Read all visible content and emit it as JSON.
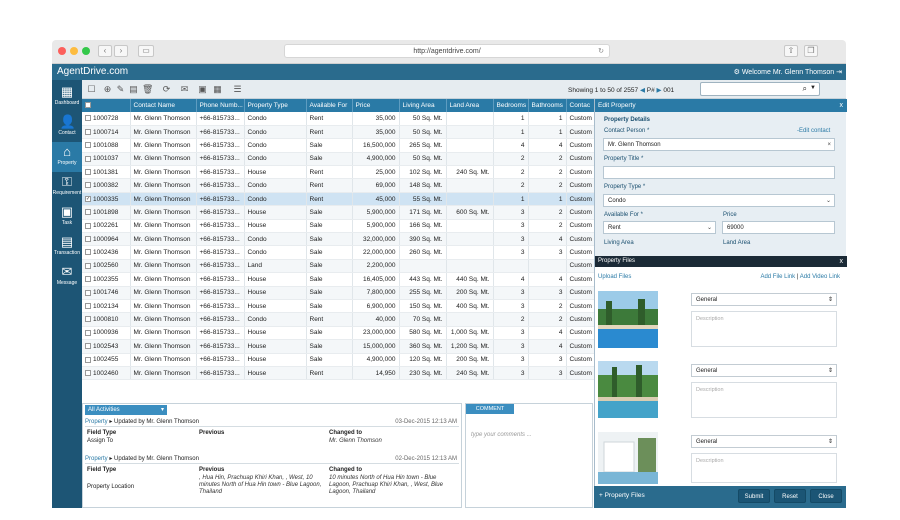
{
  "browser": {
    "url": "http://agentdrive.com/"
  },
  "app": {
    "logo": "AgentDrive.com",
    "welcome": "Welcome Mr. Glenn Thomson"
  },
  "sidebar": {
    "items": [
      {
        "label": "Dashboard",
        "icon": "dashboard-icon",
        "glyph": "▦"
      },
      {
        "label": "Contact",
        "icon": "contact-icon",
        "glyph": "👤"
      },
      {
        "label": "Property",
        "icon": "home-icon",
        "glyph": "⌂"
      },
      {
        "label": "Requirement",
        "icon": "key-icon",
        "glyph": "⚿"
      },
      {
        "label": "Task",
        "icon": "calendar-icon",
        "glyph": "▣"
      },
      {
        "label": "Transaction",
        "icon": "briefcase-icon",
        "glyph": "▤"
      },
      {
        "label": "Message",
        "icon": "mail-icon",
        "glyph": "✉"
      }
    ]
  },
  "toolbar": {
    "showing": "Showing 1 to 50 of 2557",
    "page_label": "P#",
    "page": "001"
  },
  "table": {
    "columns": [
      "",
      "Contact Name",
      "Phone Numb...",
      "Property Type",
      "Available For",
      "Price",
      "Living Area",
      "Land Area",
      "Bedrooms",
      "Bathrooms",
      "Contac"
    ],
    "rows": [
      [
        "1000728",
        "Mr. Glenn Thomson",
        "+66-815733...",
        "Condo",
        "Rent",
        "35,000",
        "50 Sq. Mt.",
        "",
        "1",
        "1",
        "Custom"
      ],
      [
        "1000714",
        "Mr. Glenn Thomson",
        "+66-815733...",
        "Condo",
        "Rent",
        "35,000",
        "50 Sq. Mt.",
        "",
        "1",
        "1",
        "Custom"
      ],
      [
        "1001088",
        "Mr. Glenn Thomson",
        "+66-815733...",
        "Condo",
        "Sale",
        "16,500,000",
        "265 Sq. Mt.",
        "",
        "4",
        "4",
        "Custom"
      ],
      [
        "1001037",
        "Mr. Glenn Thomson",
        "+66-815733...",
        "Condo",
        "Sale",
        "4,900,000",
        "50 Sq. Mt.",
        "",
        "2",
        "2",
        "Custom"
      ],
      [
        "1001381",
        "Mr. Glenn Thomson",
        "+66-815733...",
        "House",
        "Rent",
        "25,000",
        "102 Sq. Mt.",
        "240 Sq. Mt.",
        "2",
        "2",
        "Custom"
      ],
      [
        "1000382",
        "Mr. Glenn Thomson",
        "+66-815733...",
        "Condo",
        "Rent",
        "69,000",
        "148 Sq. Mt.",
        "",
        "2",
        "2",
        "Custom"
      ],
      [
        "1000335",
        "Mr. Glenn Thomson",
        "+66-815733...",
        "Condo",
        "Rent",
        "45,000",
        "55 Sq. Mt.",
        "",
        "1",
        "1",
        "Custom"
      ],
      [
        "1001898",
        "Mr. Glenn Thomson",
        "+66-815733...",
        "House",
        "Sale",
        "5,900,000",
        "171 Sq. Mt.",
        "600 Sq. Mt.",
        "3",
        "2",
        "Custom"
      ],
      [
        "1002261",
        "Mr. Glenn Thomson",
        "+66-815733...",
        "House",
        "Sale",
        "5,900,000",
        "166 Sq. Mt.",
        "",
        "3",
        "2",
        "Custom"
      ],
      [
        "1000964",
        "Mr. Glenn Thomson",
        "+66-815733...",
        "Condo",
        "Sale",
        "32,000,000",
        "390 Sq. Mt.",
        "",
        "3",
        "4",
        "Custom"
      ],
      [
        "1002436",
        "Mr. Glenn Thomson",
        "+66-815733...",
        "Condo",
        "Sale",
        "22,000,000",
        "260 Sq. Mt.",
        "",
        "3",
        "3",
        "Custom"
      ],
      [
        "1002560",
        "Mr. Glenn Thomson",
        "+66-815733...",
        "Land",
        "Sale",
        "2,200,000",
        "",
        "",
        "",
        "",
        "Custom"
      ],
      [
        "1002355",
        "Mr. Glenn Thomson",
        "+66-815733...",
        "House",
        "Sale",
        "16,405,000",
        "443 Sq. Mt.",
        "440 Sq. Mt.",
        "4",
        "4",
        "Custom"
      ],
      [
        "1001746",
        "Mr. Glenn Thomson",
        "+66-815733...",
        "House",
        "Sale",
        "7,800,000",
        "255 Sq. Mt.",
        "200 Sq. Mt.",
        "3",
        "3",
        "Custom"
      ],
      [
        "1002134",
        "Mr. Glenn Thomson",
        "+66-815733...",
        "House",
        "Sale",
        "6,900,000",
        "150 Sq. Mt.",
        "400 Sq. Mt.",
        "3",
        "2",
        "Custom"
      ],
      [
        "1000810",
        "Mr. Glenn Thomson",
        "+66-815733...",
        "Condo",
        "Rent",
        "40,000",
        "70 Sq. Mt.",
        "",
        "2",
        "2",
        "Custom"
      ],
      [
        "1000936",
        "Mr. Glenn Thomson",
        "+66-815733...",
        "House",
        "Sale",
        "23,000,000",
        "580 Sq. Mt.",
        "1,000 Sq. Mt.",
        "3",
        "4",
        "Custom"
      ],
      [
        "1002543",
        "Mr. Glenn Thomson",
        "+66-815733...",
        "House",
        "Sale",
        "15,000,000",
        "360 Sq. Mt.",
        "1,200 Sq. Mt.",
        "3",
        "4",
        "Custom"
      ],
      [
        "1002455",
        "Mr. Glenn Thomson",
        "+66-815733...",
        "House",
        "Sale",
        "4,900,000",
        "120 Sq. Mt.",
        "200 Sq. Mt.",
        "3",
        "3",
        "Custom"
      ],
      [
        "1002460",
        "Mr. Glenn Thomson",
        "+66-815733...",
        "House",
        "Rent",
        "14,950",
        "230 Sq. Mt.",
        "240 Sq. Mt.",
        "3",
        "3",
        "Custom"
      ]
    ],
    "selected_row": 6
  },
  "activity": {
    "filter": "All Activities",
    "entries": [
      {
        "link": "Property",
        "text": "Updated by Mr. Glenn Thomson",
        "date": "03-Dec-2015 12:13 AM",
        "h_field": "Field Type",
        "h_prev": "Previous",
        "h_changed": "Changed to",
        "field": "Assign To",
        "prev": "",
        "changed": "Mr. Glenn Thomson"
      },
      {
        "link": "Property",
        "text": "Updated by Mr. Glenn Thomson",
        "date": "02-Dec-2015 12:13 AM",
        "h_field": "Field Type",
        "h_prev": "Previous",
        "h_changed": "Changed to",
        "field": "Property Location",
        "prev": ", Hua Hin, Prachuap Khiri Khan, , West, 10 minutes North of Hua Hin town - Blue Lagoon, Thailand",
        "changed": "10 minutes North of Hua Hin town - Blue Lagoon, Prachuap Khiri Khan, , West, Blue Lagoon, Thailand"
      }
    ]
  },
  "comment": {
    "tab": "COMMENT",
    "placeholder": "type your comments ..."
  },
  "edit": {
    "title": "Edit Property",
    "section": "Property Details",
    "contact_label": "Contact Person *",
    "edit_contact": "-Edit contact",
    "contact_value": "Mr. Glenn Thomson",
    "title_label": "Property Title *",
    "type_label": "Property Type *",
    "type_value": "Condo",
    "avail_label": "Available For *",
    "avail_value": "Rent",
    "price_label": "Price",
    "price_value": "69000",
    "living_label": "Living Area",
    "land_label": "Land Area"
  },
  "files": {
    "title": "Property Files",
    "upload": "Upload Files",
    "add_file": "Add File Link",
    "sep": "|",
    "add_video": "Add Video Link",
    "items": [
      {
        "category": "General",
        "desc": "Description"
      },
      {
        "category": "General",
        "desc": "Description"
      },
      {
        "category": "General",
        "desc": "Description"
      }
    ]
  },
  "footer": {
    "add_files": "+ Property Files",
    "submit": "Submit",
    "reset": "Reset",
    "close": "Close"
  }
}
